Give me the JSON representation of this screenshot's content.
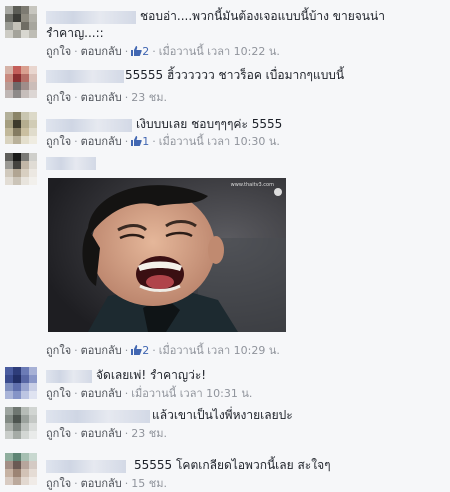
{
  "comments": [
    {
      "text_line1": "ชอบอ่า....พวกนี้มันต้องเจอแบบนี้บ้าง ขายจนน่า",
      "text_line2": "รำคาญ...::",
      "like": "ถูกใจ",
      "reply": "ตอบกลับ",
      "likes": "2",
      "time": "เมื่อวานนี้ เวลา 10:22 น."
    },
    {
      "text": "55555 ฮิ้วววววว ชาวร็อค เบื่อมากๆแบบนี้",
      "like": "ถูกใจ",
      "reply": "ตอบกลับ",
      "time": "23 ชม."
    },
    {
      "text": "เงิบบบเลย ชอบๆๆๆค่ะ 5555",
      "like": "ถูกใจ",
      "reply": "ตอบกลับ",
      "likes": "1",
      "time": "เมื่อวานนี้ เวลา 10:30 น."
    },
    {
      "photo_watermark": "www.thaitv3.com",
      "like": "ถูกใจ",
      "reply": "ตอบกลับ",
      "likes": "2",
      "time": "เมื่อวานนี้ เวลา 10:29 น."
    },
    {
      "text": "จัดเลยเพ่! รำคาญว่ะ!",
      "like": "ถูกใจ",
      "reply": "ตอบกลับ",
      "time": "เมื่อวานนี้ เวลา 10:31 น."
    },
    {
      "text": "แล้วเขาเป็นไงพี่หงายเลยปะ",
      "like": "ถูกใจ",
      "reply": "ตอบกลับ",
      "time": "23 ชม."
    },
    {
      "text": "55555 โคตเกลียดไอพวกนี้เลย สะใจๆ",
      "like": "ถูกใจ",
      "reply": "ตอบกลับ",
      "time": "15 ชม."
    }
  ],
  "colors": {
    "link": "#4b4f56",
    "meta": "#90949c",
    "like_blue": "#4267b2"
  }
}
